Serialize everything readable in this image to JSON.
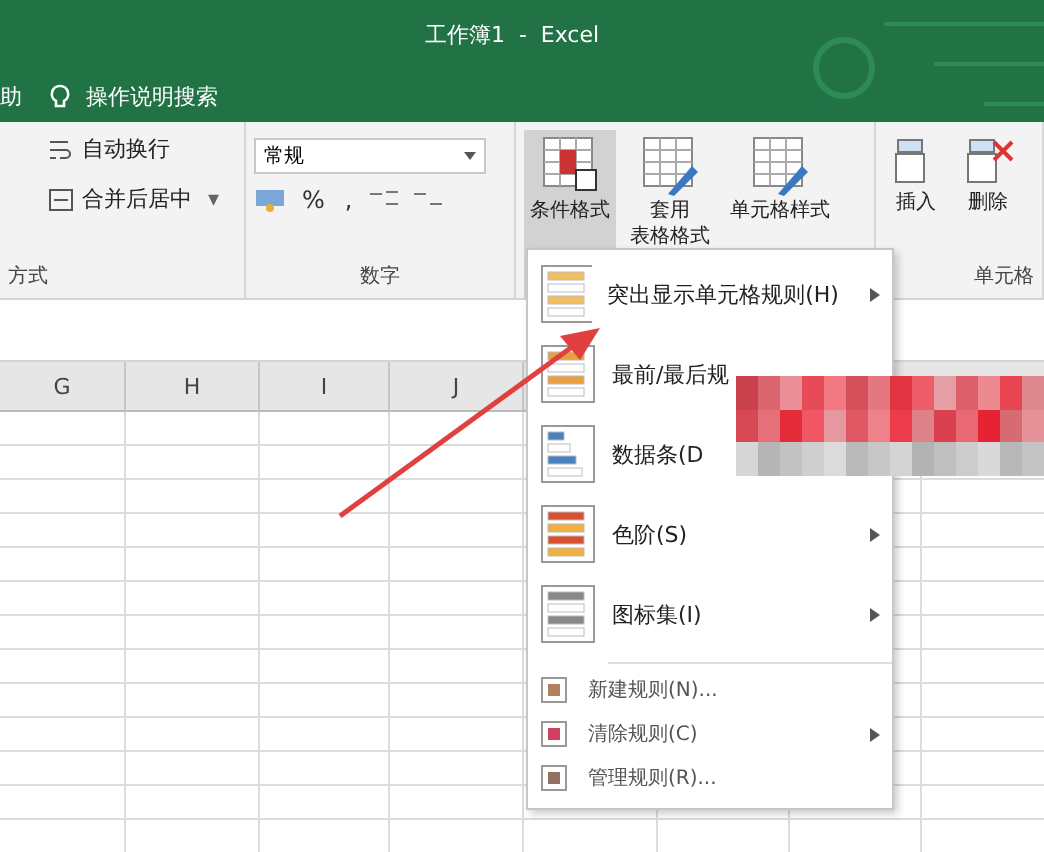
{
  "window": {
    "title": "工作簿1  -  Excel"
  },
  "tell_bar": {
    "tab": "助",
    "search": "操作说明搜索"
  },
  "alignment_group": {
    "buttons": [
      {
        "kind": "wrap",
        "label": "自动换行"
      },
      {
        "kind": "merge",
        "label": "合并后居中",
        "dropdown": "▾"
      }
    ],
    "label": "方式"
  },
  "number_group": {
    "format": "常规",
    "percent": "%",
    "comma": ",",
    "label": "数字"
  },
  "styles_group": {
    "buttons": [
      {
        "kind": "conditional",
        "lines": [
          "条件格式"
        ],
        "selected": true
      },
      {
        "kind": "table",
        "lines": [
          "套用",
          "表格格式"
        ],
        "selected": false
      },
      {
        "kind": "cell",
        "lines": [
          "单元格样式"
        ],
        "selected": false
      }
    ]
  },
  "cells_group": {
    "buttons": [
      {
        "kind": "insert",
        "label": "插入"
      },
      {
        "kind": "delete",
        "label": "删除"
      }
    ],
    "label": "单元格"
  },
  "columns": [
    "G",
    "H",
    "I",
    "J"
  ],
  "menu": {
    "items": [
      {
        "kind": "highlight",
        "label": "突出显示单元格规则(H)",
        "submenu": true
      },
      {
        "kind": "topbottom",
        "label": "最前/最后规",
        "submenu": false
      },
      {
        "kind": "databar",
        "label": "数据条(D",
        "submenu": false
      },
      {
        "kind": "colorscale",
        "label": "色阶(S)",
        "submenu": true
      },
      {
        "kind": "iconset",
        "label": "图标集(I)",
        "submenu": true
      },
      {
        "kind": "new",
        "label": "新建规则(N)...",
        "submenu": false
      },
      {
        "kind": "clear",
        "label": "清除规则(C)",
        "submenu": true
      },
      {
        "kind": "manage",
        "label": "管理规则(R)...",
        "submenu": false
      }
    ]
  }
}
